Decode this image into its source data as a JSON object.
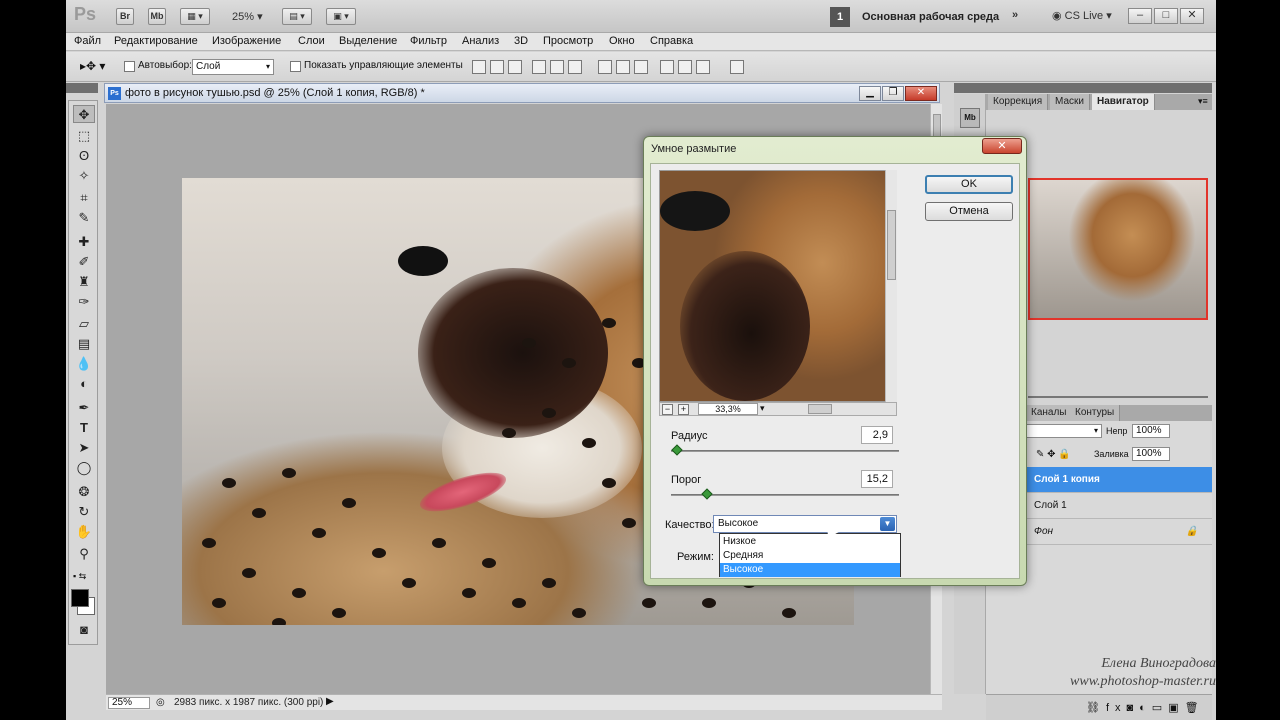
{
  "appbar": {
    "logo": "Ps",
    "br": "Br",
    "mb": "Mb",
    "zoom": "25%",
    "workspace_num": "1",
    "workspace": "Основная рабочая среда",
    "cs_live": "CS Live"
  },
  "menu": [
    "Файл",
    "Редактирование",
    "Изображение",
    "Слои",
    "Выделение",
    "Фильтр",
    "Анализ",
    "3D",
    "Просмотр",
    "Окно",
    "Справка"
  ],
  "options": {
    "autoselect_label": "Автовыбор:",
    "autoselect_value": "Слой",
    "show_controls_label": "Показать управляющие элементы"
  },
  "document": {
    "title": "фото в рисунок тушью.psd @ 25% (Слой 1 копия, RGB/8) *",
    "zoom": "25%",
    "info": "2983 пикс. x 1987 пикс. (300 ppi)"
  },
  "panels": {
    "top_tabs": [
      "Коррекция",
      "Маски",
      "Навигатор"
    ],
    "layer_tabs": [
      "Каналы",
      "Контуры"
    ],
    "opacity_label": "Непр",
    "opacity_value": "100%",
    "fill_label": "Заливка",
    "fill_value": "100%",
    "layers": [
      "Слой 1 копия",
      "Слой 1",
      "Фон"
    ]
  },
  "dialog": {
    "title": "Умное размытие",
    "ok": "OK",
    "cancel": "Отмена",
    "zoom": "33,3%",
    "radius_label": "Радиус",
    "radius_value": "2,9",
    "threshold_label": "Порог",
    "threshold_value": "15,2",
    "quality_label": "Качество:",
    "quality_value": "Высокое",
    "mode_label": "Режим:",
    "options": [
      "Низкое",
      "Средняя",
      "Высокое"
    ]
  },
  "watermark": {
    "line1": "Елена Виноградова",
    "line2": "www.photoshop-master.ru"
  }
}
